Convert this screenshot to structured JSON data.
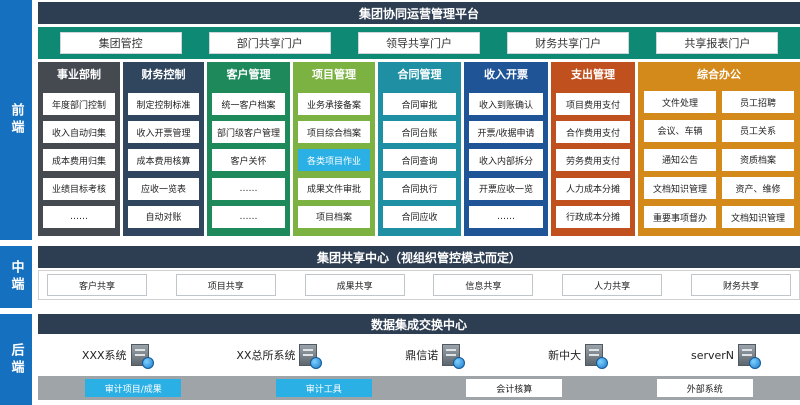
{
  "side_labels": {
    "front": "前端",
    "middle": "中端",
    "back": "后端"
  },
  "top_title": "集团协同运营管理平台",
  "portals": [
    "集团管控",
    "部门共享门户",
    "领导共享门户",
    "财务共享门户",
    "共享报表门户"
  ],
  "columns": [
    {
      "title": "事业部制",
      "color": "#444a50",
      "items": [
        "年度部门控制",
        "收入自动归集",
        "成本费用归集",
        "业绩目标考核",
        "……"
      ]
    },
    {
      "title": "财务控制",
      "color": "#30455e",
      "items": [
        "制定控制标准",
        "收入开票管理",
        "成本费用核算",
        "应收一览表",
        "自动对账"
      ]
    },
    {
      "title": "客户管理",
      "color": "#1e8a5c",
      "items": [
        "统一客户档案",
        "部门级客户管理",
        "客户关怀",
        "……",
        "……"
      ]
    },
    {
      "title": "项目管理",
      "color": "#7bb241",
      "items": [
        "业务承接备案",
        "项目综合档案",
        "各类项目作业",
        "成果文件审批",
        "项目档案"
      ]
    },
    {
      "title": "合同管理",
      "color": "#1f8fa3",
      "items": [
        "合同审批",
        "合同台账",
        "合同查询",
        "合同执行",
        "合同应收"
      ]
    },
    {
      "title": "收入开票",
      "color": "#1f5597",
      "items": [
        "收入到账确认",
        "开票/收据申请",
        "收入内部拆分",
        "开票应收一览",
        "……"
      ]
    },
    {
      "title": "支出管理",
      "color": "#c0501e",
      "items": [
        "项目费用支付",
        "合作费用支付",
        "劳务费用支付",
        "人力成本分摊",
        "行政成本分摊"
      ]
    },
    {
      "title": "综合办公",
      "color": "#d48a1a",
      "items": [
        "文件处理",
        "员工招聘",
        "会议、车辆",
        "员工关系",
        "通知公告",
        "资质档案",
        "文档知识管理",
        "资产、维修",
        "重要事项督办",
        "文档知识管理"
      ]
    }
  ],
  "middle_title": "集团共享中心（视组织管控模式而定）",
  "shared_items": [
    "客户共享",
    "项目共享",
    "成果共享",
    "信息共享",
    "人力共享",
    "财务共享"
  ],
  "back_title": "数据集成交换中心",
  "systems": [
    "XXX系统",
    "XX总所系统",
    "鼎信诺",
    "新中大",
    "serverN"
  ],
  "bottom_items": [
    "审计项目/成果",
    "审计工具",
    "会计核算",
    "外部系统"
  ],
  "colors": {
    "side": "#1670c0",
    "band": "#2e3e52",
    "portal_bar": "#0e8a74",
    "highlight": "#2bb0e6"
  }
}
